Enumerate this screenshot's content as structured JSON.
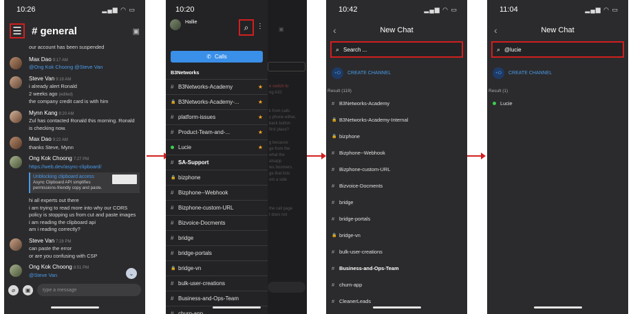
{
  "colors": {
    "phone_bg": "#2b2b2d",
    "accent": "#3a8fe8",
    "highlight": "#d21f1f",
    "star": "#f5a623",
    "online": "#3ccf4e"
  },
  "screen1": {
    "time": "10:26",
    "channel": "# general",
    "system_line": "our account has been suspended",
    "messages": [
      {
        "author": "Max Dao",
        "time": "9:17 AM",
        "lines": [
          "@Ong Kok Choong  @Steve Van"
        ]
      },
      {
        "author": "Steve Van",
        "time": "9:18 AM",
        "lines": [
          "i already alert Ronald",
          "2 weeks ago",
          "the company credit card is with him"
        ],
        "edited": "(edited)"
      },
      {
        "author": "Mynn Kang",
        "time": "9:20 AM",
        "lines": [
          "Zul has contacted Ronald this morning.  Ronald is checking now."
        ]
      },
      {
        "author": "Max Dao",
        "time": "9:22 AM",
        "lines": [
          "thanks Steve, Mynn"
        ]
      },
      {
        "author": "Ong Kok Choong",
        "time": "7:27 PM",
        "link": "https://web.dev/async-clipboard/",
        "preview_title": "Unblocking clipboard access",
        "preview_desc": "Async Clipboard API simplifies permissions-friendly copy and paste.",
        "lines": [
          "hi all experts out there",
          "i am trying to read more into why our CORS policy is stopping us from cut and paste images",
          "i am reading the clipboard api",
          "am i reading correctly?"
        ]
      },
      {
        "author": "Steve Van",
        "time": "7:28 PM",
        "lines": [
          "can paste the error",
          "or are you confusing with CSP"
        ]
      },
      {
        "author": "Ong Kok Choong",
        "time": "8:51 PM",
        "lines": [
          "@Steve Van"
        ]
      }
    ],
    "composer_placeholder": "type a message"
  },
  "screen2": {
    "time": "10:20",
    "user": "Hallie",
    "calls_label": "Calls",
    "workspace": "B3Networks",
    "items": [
      {
        "prefix": "#",
        "label": "B3Networks-Academy",
        "star": true
      },
      {
        "prefix": "🔒",
        "label": "B3Networks-Academy-...",
        "star": true
      },
      {
        "prefix": "#",
        "label": "platform-issues",
        "star": true
      },
      {
        "prefix": "#",
        "label": "Product-Team-and-...",
        "star": true
      },
      {
        "prefix": "dot",
        "label": "Lucie",
        "star": true
      },
      {
        "prefix": "#",
        "label": "SA-Support",
        "bold": true
      },
      {
        "prefix": "🔒",
        "label": "bizphone"
      },
      {
        "prefix": "#",
        "label": "Bizphone--Webhook"
      },
      {
        "prefix": "#",
        "label": "Bizphone-custom-URL"
      },
      {
        "prefix": "#",
        "label": "Bizvoice-Docments"
      },
      {
        "prefix": "#",
        "label": "bridge"
      },
      {
        "prefix": "#",
        "label": "bridge-portals"
      },
      {
        "prefix": "🔒",
        "label": "bridge-vn"
      },
      {
        "prefix": "#",
        "label": "bulk-user-creations"
      },
      {
        "prefix": "#",
        "label": "Business-and-Ops-Team"
      },
      {
        "prefix": "#",
        "label": "churn-app"
      }
    ],
    "ghost_lines": [
      "ng A32",
      "k from calls",
      "y phone either,",
      "back button",
      "first place?",
      "g because",
      "ge from the",
      "what the",
      "atsapp",
      "tes boomers.",
      "ge that lists",
      "om a side",
      "the call page",
      "t does not"
    ]
  },
  "screen3": {
    "time": "10:42",
    "title": "New Chat",
    "search_placeholder": "Search ...",
    "create_label": "CREATE CHANNEL",
    "result_label": "Result (119)",
    "results": [
      {
        "prefix": "#",
        "label": "B3Networks-Academy"
      },
      {
        "prefix": "🔒",
        "label": "B3Networks-Academy-Internal"
      },
      {
        "prefix": "🔒",
        "label": "bizphone"
      },
      {
        "prefix": "#",
        "label": "Bizphone--Webhook"
      },
      {
        "prefix": "#",
        "label": "Bizphone-custom-URL"
      },
      {
        "prefix": "#",
        "label": "Bizvoice-Docments"
      },
      {
        "prefix": "#",
        "label": "bridge"
      },
      {
        "prefix": "#",
        "label": "bridge-portals"
      },
      {
        "prefix": "🔒",
        "label": "bridge-vn"
      },
      {
        "prefix": "#",
        "label": "bulk-user-creations"
      },
      {
        "prefix": "#",
        "label": "Business-and-Ops-Team",
        "bold": true
      },
      {
        "prefix": "#",
        "label": "churn-app"
      },
      {
        "prefix": "#",
        "label": "CleanerLeads"
      }
    ]
  },
  "screen4": {
    "time": "11:04",
    "title": "New Chat",
    "search_value": "@lucie",
    "create_label": "CREATE CHANNEL",
    "result_label": "Result (1)",
    "results": [
      {
        "prefix": "dot",
        "label": "Lucie"
      }
    ]
  }
}
